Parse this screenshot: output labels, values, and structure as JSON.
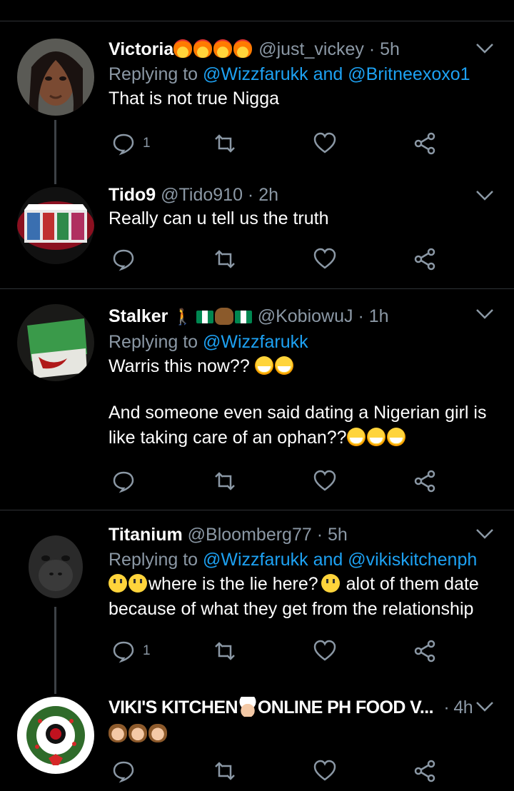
{
  "colors": {
    "background": "#000000",
    "link": "#1da1f2",
    "muted": "#8b98a5",
    "divider": "#2f3336"
  },
  "tweets": [
    {
      "name": "Victoria",
      "name_emoji": [
        "fire",
        "fire",
        "fire",
        "fire"
      ],
      "handle": "@just_vickey",
      "sep": "·",
      "time": "5h",
      "reply_prefix": "Replying to",
      "reply_mentions": "@Wizzfarukk and @Britneexoxo1",
      "text": "That is not true Nigga",
      "reply_count": "1",
      "avatar": "avatar-victoria"
    },
    {
      "name": "Tido9",
      "handle": "@Tido910",
      "sep": "·",
      "time": "2h",
      "text": "Really can u tell us the truth",
      "reply_count": "",
      "avatar": "avatar-tido9"
    },
    {
      "name": "Stalker",
      "handle": "@KobiowuJ",
      "sep": "·",
      "time": "1h",
      "reply_prefix": "Replying to",
      "reply_mentions": "@Wizzfarukk",
      "text_line1": "Warris this now??",
      "text_line2": "And someone even said dating a Nigerian girl is",
      "text_line3": "like taking care of an ophan??",
      "reply_count": "",
      "avatar": "avatar-stalker"
    },
    {
      "name": "Titanium",
      "handle": "@Bloomberg77",
      "sep": "·",
      "time": "5h",
      "reply_prefix": "Replying to",
      "reply_mentions": "@Wizzfarukk and @vikiskitchenph",
      "text_part1": "where is the lie here?",
      "text_part2": "alot of them date",
      "text_line2": "because of what they get from the relationship",
      "reply_count": "1",
      "avatar": "avatar-titanium"
    },
    {
      "name_part1": "VIKI'S KITCHEN",
      "name_part2": "ONLINE PH FOOD V...",
      "sep": "·",
      "time": "4h",
      "reply_count": "",
      "avatar": "avatar-vikis-kitchen"
    }
  ],
  "icons": {
    "reply": "reply-icon",
    "retweet": "retweet-icon",
    "like": "heart-icon",
    "share": "share-icon",
    "menu": "chevron-down-icon"
  }
}
